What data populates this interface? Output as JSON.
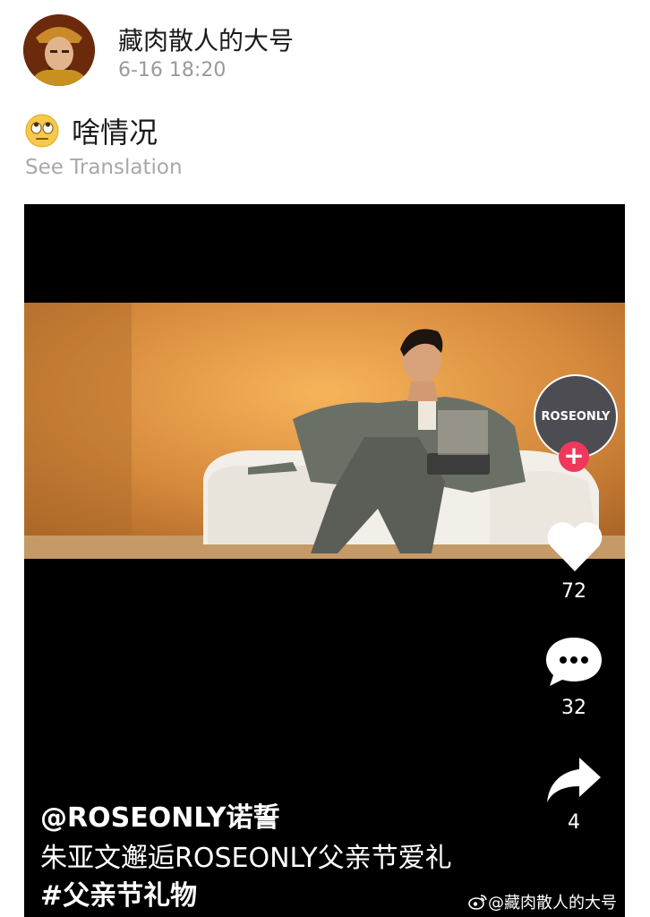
{
  "header": {
    "username": "藏肉散人的大号",
    "timestamp": "6-16 18:20",
    "avatar_icon": "emperor-portrait"
  },
  "post": {
    "emoji_icon": "rolling-eyes-emoji",
    "text": "啥情况",
    "see_translation": "See Translation"
  },
  "video": {
    "brand_avatar_text": "ROSEONLY",
    "follow_symbol": "+",
    "likes": "72",
    "comments": "32",
    "shares": "4",
    "author": "@ROSEONLY诺誓",
    "caption_prefix": "朱亚文邂逅ROSEONLY父亲节爱礼",
    "caption_tag": "#父亲节礼物",
    "watermark": "@藏肉散人的大号",
    "accent_color": "#f0385c"
  }
}
